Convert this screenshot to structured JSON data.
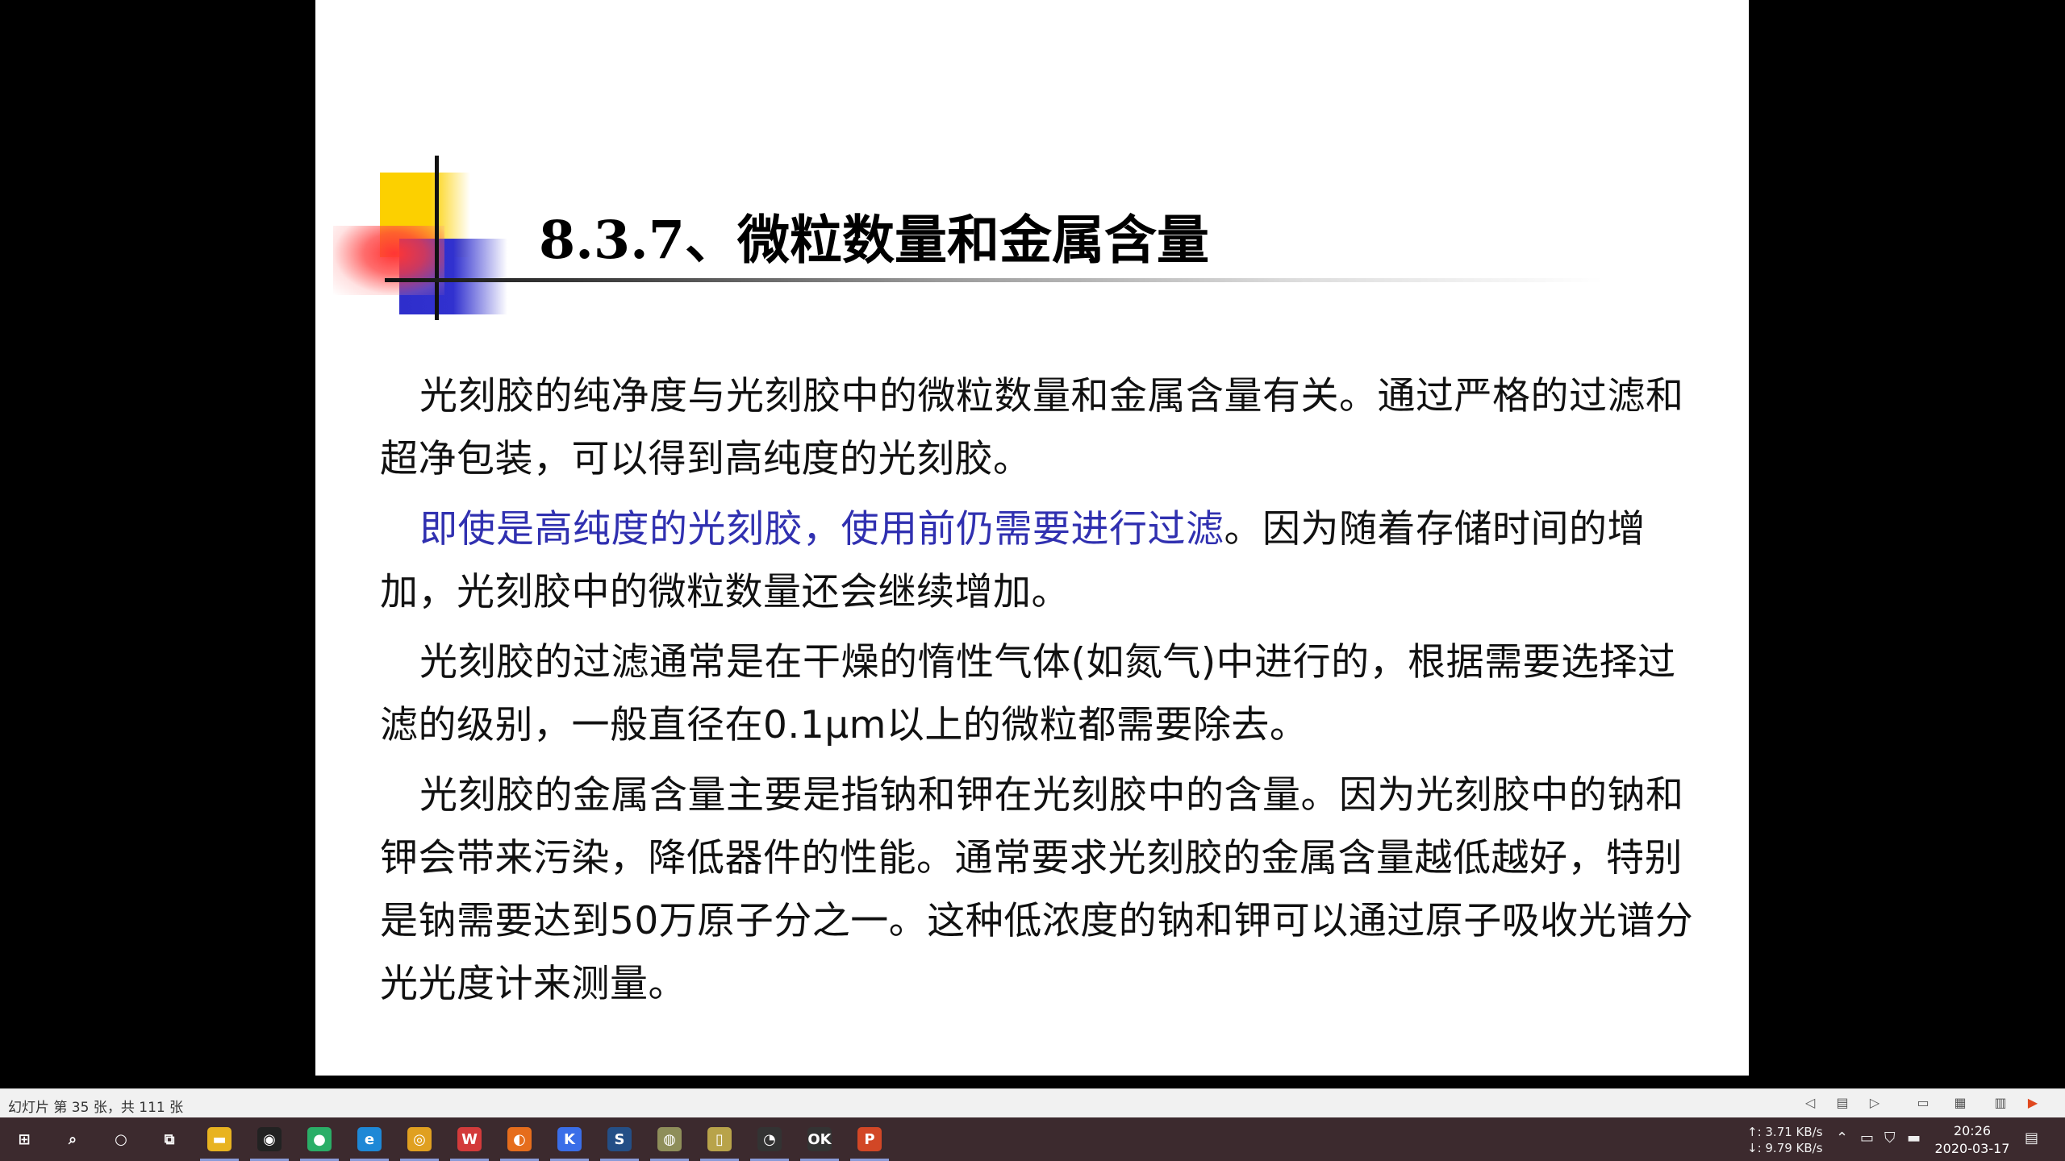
{
  "slide": {
    "title": "8.3.7、微粒数量和金属含量",
    "paragraphs": [
      {
        "text": "光刻胶的纯净度与光刻胶中的微粒数量和金属含量有关。通过严格的过滤和超净包装，可以得到高纯度的光刻胶。"
      },
      {
        "highlight": "即使是高纯度的光刻胶，使用前仍需要进行过滤",
        "text": "。因为随着存储时间的增加，光刻胶中的微粒数量还会继续增加。"
      },
      {
        "text": "光刻胶的过滤通常是在干燥的惰性气体(如氮气)中进行的，根据需要选择过滤的级别，一般直径在0.1μm以上的微粒都需要除去。"
      },
      {
        "text": "光刻胶的金属含量主要是指钠和钾在光刻胶中的含量。因为光刻胶中的钠和钾会带来污染，降低器件的性能。通常要求光刻胶的金属含量越低越好，特别是钠需要达到50万原子分之一。这种低浓度的钠和钾可以通过原子吸收光谱分光光度计来测量。"
      }
    ],
    "colors": {
      "highlight": "#3030b0",
      "text": "#111111",
      "deco_yellow": "#fcd000",
      "deco_blue": "#3131cf",
      "deco_red": "#ff3535"
    }
  },
  "statusbar": {
    "slide_counter": "幻灯片 第 35 张，共 111 张",
    "icons": [
      "prev-icon",
      "notes-icon",
      "next-icon",
      "normal-view-icon",
      "sorter-view-icon",
      "reading-view-icon",
      "slideshow-icon"
    ]
  },
  "taskbar": {
    "apps": [
      {
        "name": "start",
        "glyph": "⊞",
        "color": "transparent"
      },
      {
        "name": "search",
        "glyph": "⌕",
        "color": "transparent"
      },
      {
        "name": "cortana",
        "glyph": "○",
        "color": "transparent"
      },
      {
        "name": "task-view",
        "glyph": "⧉",
        "color": "transparent"
      },
      {
        "name": "file-explorer",
        "glyph": "▬",
        "color": "#e8b320"
      },
      {
        "name": "qq",
        "glyph": "◉",
        "color": "#222"
      },
      {
        "name": "wechat",
        "glyph": "●",
        "color": "#2aae67"
      },
      {
        "name": "edge",
        "glyph": "e",
        "color": "#1e88d6"
      },
      {
        "name": "chrome",
        "glyph": "◎",
        "color": "#e0a020"
      },
      {
        "name": "wps",
        "glyph": "W",
        "color": "#d33b3b"
      },
      {
        "name": "firefox",
        "glyph": "◐",
        "color": "#e66d1c"
      },
      {
        "name": "app-k",
        "glyph": "K",
        "color": "#3a6ee8"
      },
      {
        "name": "app-s",
        "glyph": "S",
        "color": "#244f86"
      },
      {
        "name": "app-disk",
        "glyph": "◍",
        "color": "#8e8e5a"
      },
      {
        "name": "app-phone",
        "glyph": "▯",
        "color": "#b8a34a"
      },
      {
        "name": "obs",
        "glyph": "◔",
        "color": "#333"
      },
      {
        "name": "app-ok",
        "glyph": "OK",
        "color": "#333"
      },
      {
        "name": "powerpoint",
        "glyph": "P",
        "color": "#d24726"
      }
    ],
    "net_up": "↑: 3.71 KB/s",
    "net_down": "↓: 9.79 KB/s",
    "time": "20:26",
    "date": "2020-03-17"
  }
}
